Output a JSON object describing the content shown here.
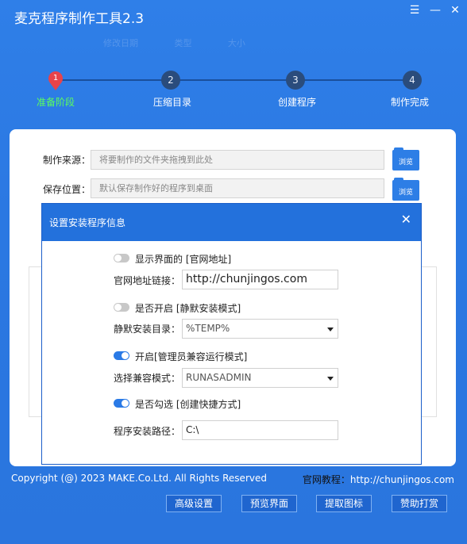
{
  "app": {
    "title": "麦克程序制作工具2.3"
  },
  "window_controls": {
    "menu": "☰",
    "minimize": "—",
    "close": "✕"
  },
  "steps": [
    {
      "num": "1",
      "label": "准备阶段"
    },
    {
      "num": "2",
      "label": "压缩目录"
    },
    {
      "num": "3",
      "label": "创建程序"
    },
    {
      "num": "4",
      "label": "制作完成"
    }
  ],
  "form": {
    "source_label": "制作来源：",
    "source_placeholder": "将要制作的文件夹拖拽到此处",
    "save_label": "保存位置：",
    "save_placeholder": "默认保存制作好的程序到桌面",
    "browse_label": "浏览"
  },
  "dialog": {
    "title": "设置安装程序信息",
    "close": "✕",
    "options": [
      {
        "label": "显示界面的 [官网地址]",
        "on": false
      },
      {
        "label": "是否开启 [静默安装模式]",
        "on": false
      },
      {
        "label": "开启[管理员兼容运行模式]",
        "on": true
      },
      {
        "label": "是否勾选 [创建快捷方式]",
        "on": true
      }
    ],
    "fields": {
      "website_label": "官网地址链接：",
      "website_value": "http://chunjingos.com",
      "silent_dir_label": "静默安装目录：",
      "silent_dir_value": "%TEMP%",
      "compat_label": "选择兼容模式：",
      "compat_value": "RUNASADMIN",
      "install_path_label": "程序安装路径：",
      "install_path_value": "C:\\"
    }
  },
  "footer": {
    "copyright": "Copyright (@) 2023 MAKE.Co.Ltd. All Rights Reserved",
    "tutorial_key": "官网教程：",
    "tutorial_url": "http://chunjingos.com",
    "buttons": [
      "高级设置",
      "预览界面",
      "提取图标",
      "赞助打赏"
    ]
  },
  "colors": {
    "window_blue": "#2b78e2",
    "active_step": "#5cff5c",
    "step_active_dot": "#e8434a",
    "toggle_on": "#2a7ae6"
  }
}
